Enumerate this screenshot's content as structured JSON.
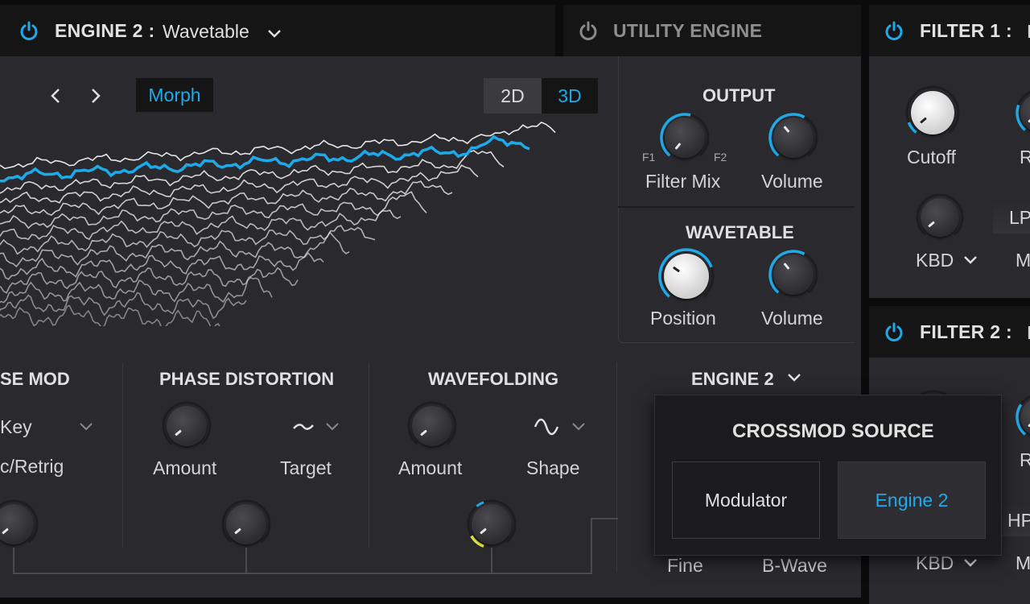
{
  "engine2_header": {
    "power_state": "on",
    "title": "ENGINE 2 :",
    "value": "Wavetable"
  },
  "utility_header": {
    "title": "UTILITY ENGINE"
  },
  "filter1_header": {
    "title": "FILTER 1 :",
    "value": "L"
  },
  "filter2_header": {
    "title": "FILTER 2 :",
    "value": "L"
  },
  "wavetable_view": {
    "mode": "Morph",
    "view_2d": "2D",
    "view_3d": "3D",
    "selected_view": "3D"
  },
  "output_section": {
    "title": "OUTPUT",
    "filter_mix": {
      "label": "Filter Mix",
      "left": "F1",
      "right": "F2"
    },
    "volume": {
      "label": "Volume"
    }
  },
  "wavetable_section": {
    "title": "WAVETABLE",
    "position": {
      "label": "Position"
    },
    "volume": {
      "label": "Volume"
    }
  },
  "phase_mod": {
    "title": "SE MOD",
    "source": "Key",
    "retrig": "c/Retrig"
  },
  "phase_distortion": {
    "title": "PHASE DISTORTION",
    "amount_label": "Amount",
    "target_label": "Target"
  },
  "wavefolding": {
    "title": "WAVEFOLDING",
    "amount_label": "Amount",
    "shape_label": "Shape"
  },
  "engine_selector": {
    "label": "ENGINE 2"
  },
  "crossmod_popup": {
    "title": "CROSSMOD SOURCE",
    "options": [
      "Modulator",
      "Engine 2"
    ],
    "selected": "Engine 2"
  },
  "tune_labels": {
    "fine": "Fine",
    "bwave": "B-Wave"
  },
  "filter1": {
    "cutoff_label": "Cutoff",
    "res_label": "R",
    "kbd_label": "KBD",
    "type_label": "LP",
    "m_label": "M"
  },
  "filter2": {
    "res_label": "R",
    "type_label": "HP",
    "kbd_label": "KBD",
    "m_label": "M"
  },
  "colors": {
    "accent": "#1ea9e8",
    "background": "#2a2a2e",
    "header": "#151516",
    "mod_yellow": "#e8e046"
  }
}
